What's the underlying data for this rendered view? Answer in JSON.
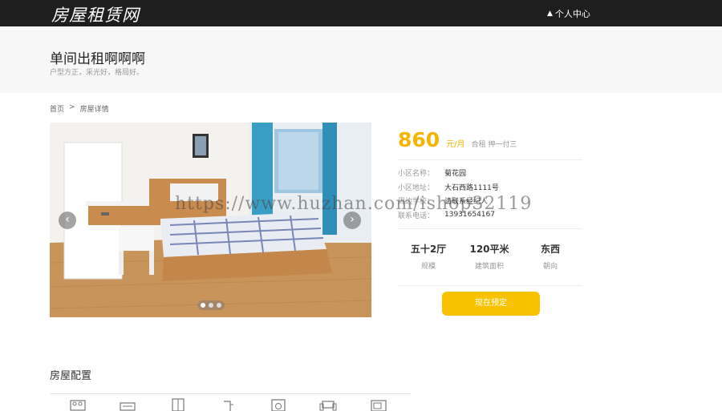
{
  "header": {
    "logo": "房屋租赁网",
    "user_center": "个人中心",
    "user_icon": "user-icon"
  },
  "hero": {
    "title": "单间出租啊啊啊",
    "subtitle": "户型方正，采光好，格局好。"
  },
  "breadcrumb": {
    "home": "首页",
    "separator": ">",
    "current": "房屋详情"
  },
  "carousel": {
    "prev": "‹",
    "next": "›",
    "slides": 3,
    "active_slide": 1
  },
  "listing": {
    "price": "860",
    "unit": "元/月",
    "terms": "合租 押一付三",
    "info": [
      {
        "label": "小区名称：",
        "value": "菊花园"
      },
      {
        "label": "小区地址：",
        "value": "大石西路1111号"
      },
      {
        "label": "周边学校：",
        "value": "请联系经纪人"
      },
      {
        "label": "联系电话：",
        "value": "13931654167"
      }
    ],
    "stats": [
      {
        "value": "五十2厅",
        "label": "规模"
      },
      {
        "value": "120平米",
        "label": "建筑面积"
      },
      {
        "value": "东西",
        "label": "朝向"
      }
    ],
    "book_button": "现在预定"
  },
  "watermark": "https://www.huzhan.com/ishop32119",
  "amenities_section": {
    "title": "房屋配置",
    "icons": [
      "bed-icon",
      "air-conditioner-icon",
      "wardrobe-icon",
      "water-heater-icon",
      "washing-machine-icon",
      "sofa-icon",
      "microwave-icon"
    ]
  },
  "colors": {
    "accent": "#f5b400",
    "button": "#f8c200",
    "topbar": "#1e1e1e"
  }
}
